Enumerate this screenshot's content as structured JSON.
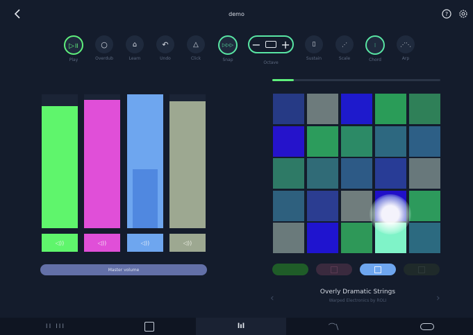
{
  "header": {
    "title": "demo"
  },
  "toolbar": {
    "play": "Play",
    "overdub": "Overdub",
    "learn": "Learn",
    "undo": "Undo",
    "click": "Click",
    "snap": "Snap",
    "octave": "Octave",
    "sustain": "Sustain",
    "scale": "Scale",
    "chord": "Chord",
    "arp": "Arp"
  },
  "octave": {
    "minus": "−",
    "plus": "+"
  },
  "mixer": {
    "master_label": "Master volume",
    "tracks": [
      {
        "color": "#5ff56c",
        "level": 0.91
      },
      {
        "color": "#e04fd8",
        "level": 0.96
      },
      {
        "color": "#6ea6ef",
        "level": 1.0,
        "highlight_level": 0.44
      },
      {
        "color": "#9da891",
        "level": 0.95
      }
    ]
  },
  "pads": {
    "colors": [
      "#263a85",
      "#6d7b7c",
      "#1e1acc",
      "#2a9c58",
      "#2f8058",
      "#2513cb",
      "#2c9c5c",
      "#2c8a66",
      "#2d6880",
      "#2d5f86",
      "#2e7a66",
      "#306b77",
      "#2d5a86",
      "#283c96",
      "#68787b",
      "#2e607e",
      "#2b3d91",
      "#707d7d",
      "#2010c8",
      "#2d9a5c",
      "#6a7a7b",
      "#1f14cf",
      "#2e9858",
      "#7ff3c8",
      "#2c6a80"
    ],
    "progress": 0.13,
    "tabs": [
      "#1f5c28",
      "#3a2a3e",
      "#6ea6ef",
      "#1f2a2a"
    ]
  },
  "preset": {
    "name": "Overly Dramatic Strings",
    "subtitle": "Warped Electronics by ROLI"
  }
}
